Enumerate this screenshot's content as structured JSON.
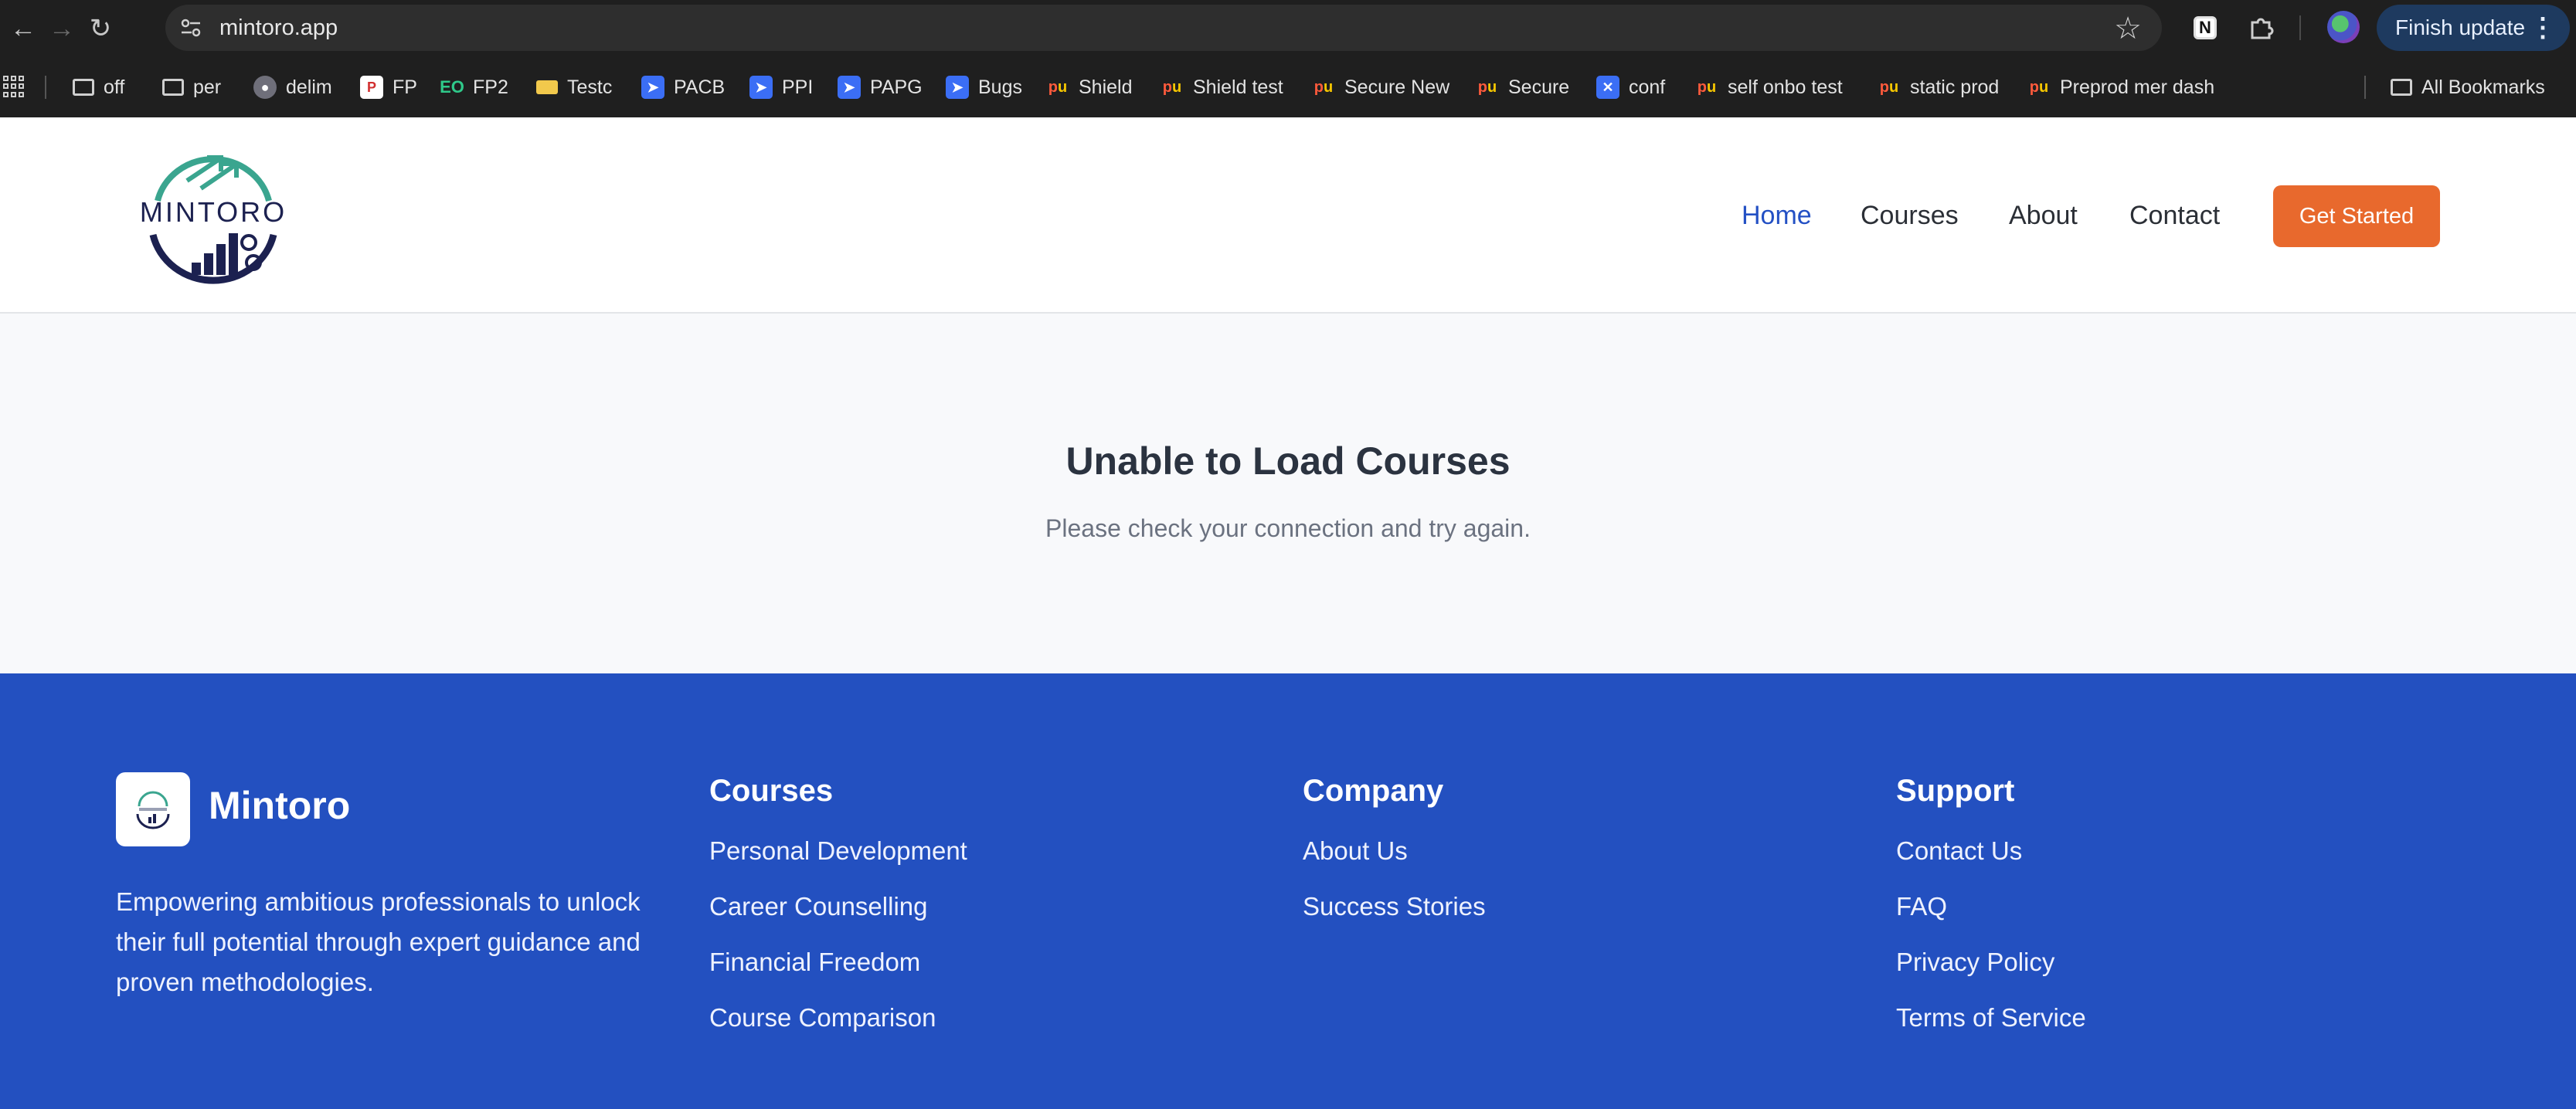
{
  "browser": {
    "url": "mintoro.app",
    "update_label": "Finish update",
    "bookmarks": [
      {
        "label": "off",
        "icon": "folder-icon"
      },
      {
        "label": "per",
        "icon": "folder-icon"
      },
      {
        "label": "delim",
        "icon": "ghost-icon"
      },
      {
        "label": "FP",
        "icon": "p-icon"
      },
      {
        "label": "FP2",
        "icon": "eo-icon"
      },
      {
        "label": "Testc",
        "icon": "card-icon"
      },
      {
        "label": "PACB",
        "icon": "jira-icon"
      },
      {
        "label": "PPI",
        "icon": "jira-icon"
      },
      {
        "label": "PAPG",
        "icon": "jira-icon"
      },
      {
        "label": "Bugs",
        "icon": "jira-icon"
      },
      {
        "label": "Shield",
        "icon": "payu-icon"
      },
      {
        "label": "Shield test",
        "icon": "payu-icon"
      },
      {
        "label": "Secure New",
        "icon": "payu-icon"
      },
      {
        "label": "Secure",
        "icon": "payu-icon"
      },
      {
        "label": "conf",
        "icon": "confluence-icon"
      },
      {
        "label": "self onbo test",
        "icon": "payu-icon"
      },
      {
        "label": "static prod",
        "icon": "payu-icon"
      },
      {
        "label": "Preprod mer dash",
        "icon": "payu-icon"
      }
    ],
    "all_bookmarks": "All Bookmarks"
  },
  "header": {
    "logo_text": "MINTORO",
    "nav": {
      "home": "Home",
      "courses": "Courses",
      "about": "About",
      "contact": "Contact"
    },
    "cta": "Get Started"
  },
  "error": {
    "title": "Unable to Load Courses",
    "message": "Please check your connection and try again."
  },
  "footer": {
    "brand": "Mintoro",
    "description": "Empowering ambitious professionals to unlock their full potential through expert guidance and proven methodologies.",
    "courses": {
      "heading": "Courses",
      "links": [
        "Personal Development",
        "Career Counselling",
        "Financial Freedom",
        "Course Comparison"
      ]
    },
    "company": {
      "heading": "Company",
      "links": [
        "About Us",
        "Success Stories"
      ]
    },
    "support": {
      "heading": "Support",
      "links": [
        "Contact Us",
        "FAQ",
        "Privacy Policy",
        "Terms of Service"
      ]
    }
  },
  "colors": {
    "accent_orange": "#e8692d",
    "brand_blue": "#2350c0",
    "nav_active": "#2350c4"
  }
}
